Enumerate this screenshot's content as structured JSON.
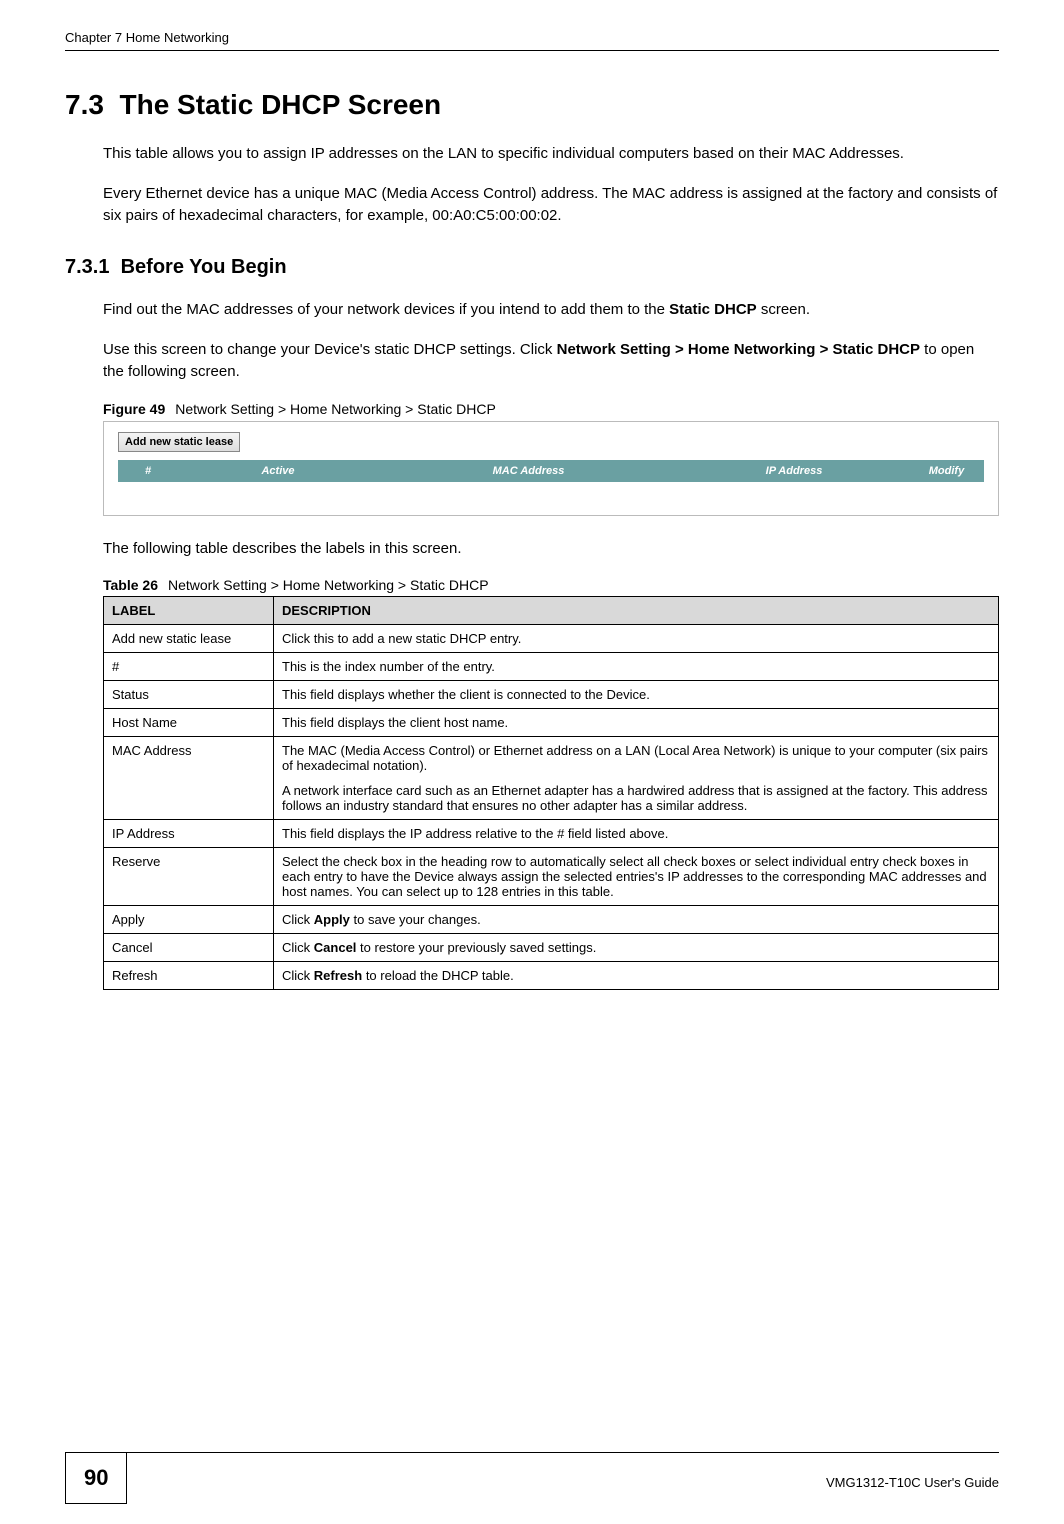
{
  "header": {
    "chapter": "Chapter 7 Home Networking"
  },
  "section": {
    "number": "7.3",
    "title": "The Static DHCP Screen",
    "para1": "This table allows you to assign IP addresses on the LAN to specific individual computers based on their MAC Addresses.",
    "para2": "Every Ethernet device has a unique MAC (Media Access Control) address. The MAC address is assigned at the factory and consists of six pairs of hexadecimal characters, for example, 00:A0:C5:00:00:02."
  },
  "subsection": {
    "number": "7.3.1",
    "title": "Before You Begin",
    "para1_a": "Find out the MAC addresses of your network devices if you intend to add them to the ",
    "para1_bold": "Static DHCP",
    "para1_b": " screen.",
    "para2_a": "Use this screen to change your Device's static DHCP settings. Click ",
    "para2_bold": "Network Setting > Home Networking > Static DHCP",
    "para2_b": " to open the following screen."
  },
  "figure": {
    "label": "Figure 49",
    "caption": "Network Setting > Home Networking > Static DHCP",
    "button": "Add new static lease",
    "cols": {
      "num": "#",
      "active": "Active",
      "mac": "MAC Address",
      "ip": "IP Address",
      "modify": "Modify"
    }
  },
  "between": "The following table describes the labels in this screen.",
  "table": {
    "label": "Table 26",
    "caption": "Network Setting > Home Networking > Static DHCP",
    "head_label": "LABEL",
    "head_desc": "DESCRIPTION",
    "rows": [
      {
        "label": "Add new static lease",
        "desc": "Click this to add a new static DHCP entry."
      },
      {
        "label": "#",
        "desc": "This is the index number of the entry."
      },
      {
        "label": "Status",
        "desc": "This field displays whether the client is connected to the Device."
      },
      {
        "label": "Host Name",
        "desc": "This field displays the client host name."
      },
      {
        "label": "MAC Address",
        "desc_p1": "The MAC (Media Access Control) or Ethernet address on a LAN (Local Area Network) is unique to your computer (six pairs of hexadecimal notation).",
        "desc_p2": "A network interface card such as an Ethernet adapter has a hardwired address that is assigned at the factory. This address follows an industry standard that ensures no other adapter has a similar address."
      },
      {
        "label": "IP Address",
        "desc": "This field displays the IP address relative to the # field listed above."
      },
      {
        "label": "Reserve",
        "desc": "Select the check box in the heading row to automatically select all check boxes or select individual entry check boxes in each entry to have the Device always assign the selected entries's IP addresses to the corresponding MAC addresses and host names. You can select up to 128 entries in this table."
      },
      {
        "label": "Apply",
        "desc_a": "Click ",
        "desc_bold": "Apply",
        "desc_b": " to save your changes."
      },
      {
        "label": "Cancel",
        "desc_a": "Click ",
        "desc_bold": "Cancel",
        "desc_b": " to restore your previously saved settings."
      },
      {
        "label": "Refresh",
        "desc_a": "Click ",
        "desc_bold": "Refresh",
        "desc_b": " to reload the DHCP table."
      }
    ]
  },
  "footer": {
    "page": "90",
    "guide": "VMG1312-T10C User's Guide"
  }
}
